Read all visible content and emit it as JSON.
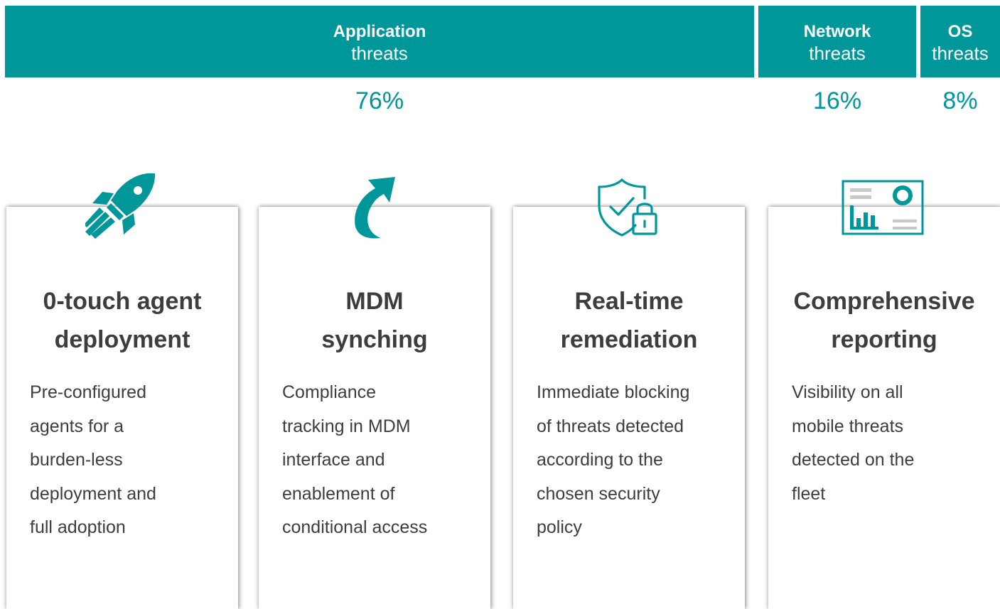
{
  "chart_data": {
    "type": "bar",
    "stacked": true,
    "orientation": "horizontal",
    "categories": [
      "Application threats",
      "Network threats",
      "OS threats"
    ],
    "series": [
      {
        "values": [
          76,
          16,
          8
        ]
      }
    ],
    "segments": [
      {
        "title": "Application",
        "subtitle": "threats",
        "value": 76,
        "label": "76%"
      },
      {
        "title": "Network",
        "subtitle": "threats",
        "value": 16,
        "label": "16%"
      },
      {
        "title": "OS",
        "subtitle": "threats",
        "value": 8,
        "label": "8%"
      }
    ],
    "bar_color": "#00979b",
    "title": "",
    "xlabel": "",
    "ylabel": ""
  },
  "colors": {
    "accent": "#00979b",
    "text": "#3d3d3d"
  },
  "cards": [
    {
      "icon": "rocket-icon",
      "title_lines": [
        "0-touch agent",
        "deployment"
      ],
      "desc_lines": [
        "Pre-configured",
        "agents for a",
        "burden-less",
        "deployment and",
        "full adoption"
      ]
    },
    {
      "icon": "sync-arrow-icon",
      "title_lines": [
        "MDM",
        "synching"
      ],
      "desc_lines": [
        "Compliance",
        "tracking in MDM",
        "interface and",
        "enablement of",
        "conditional access"
      ]
    },
    {
      "icon": "shield-lock-icon",
      "title_lines": [
        "Real-time",
        "remediation"
      ],
      "desc_lines": [
        "Immediate blocking",
        "of threats detected",
        "according to the",
        "chosen security",
        "policy"
      ]
    },
    {
      "icon": "dashboard-report-icon",
      "title_lines": [
        "Comprehensive",
        "reporting"
      ],
      "desc_lines": [
        "Visibility on all",
        "mobile threats",
        "detected on the",
        "fleet"
      ]
    }
  ]
}
